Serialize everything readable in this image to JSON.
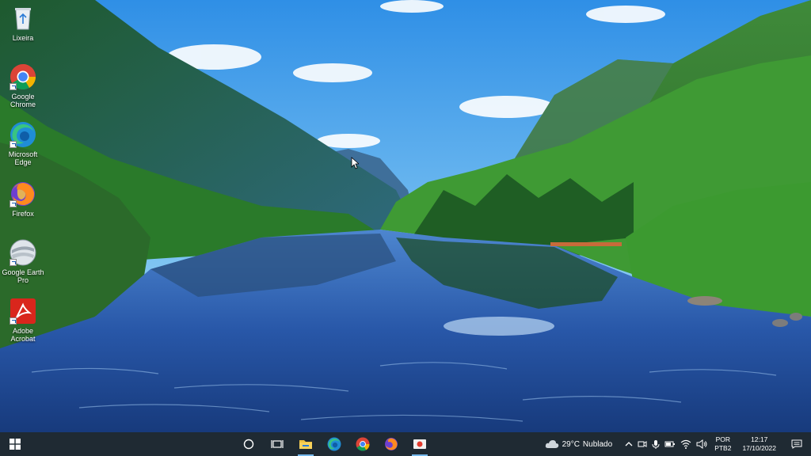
{
  "desktop": {
    "icons": [
      {
        "label": "Lixeira",
        "icon": "recycle-bin-icon"
      },
      {
        "label": "Google\nChrome",
        "icon": "chrome-icon"
      },
      {
        "label": "Microsoft\nEdge",
        "icon": "edge-icon"
      },
      {
        "label": "Firefox",
        "icon": "firefox-icon"
      },
      {
        "label": "Google Earth\nPro",
        "icon": "google-earth-icon"
      },
      {
        "label": "Adobe\nAcrobat",
        "icon": "acrobat-icon"
      }
    ]
  },
  "taskbar": {
    "apps": [
      {
        "icon": "search-circle-icon"
      },
      {
        "icon": "task-view-icon"
      },
      {
        "icon": "file-explorer-icon"
      },
      {
        "icon": "edge-icon"
      },
      {
        "icon": "chrome-icon"
      },
      {
        "icon": "firefox-icon"
      },
      {
        "icon": "screen-recorder-icon"
      }
    ],
    "weather": {
      "temp": "29°C",
      "condition": "Nublado",
      "icon": "cloud-icon"
    },
    "language": {
      "line1": "POR",
      "line2": "PTB2"
    },
    "clock": {
      "time": "12:17",
      "date": "17/10/2022"
    }
  },
  "colors": {
    "taskbar_bg": "#1f2a33",
    "active_indicator": "#76b9ed"
  }
}
